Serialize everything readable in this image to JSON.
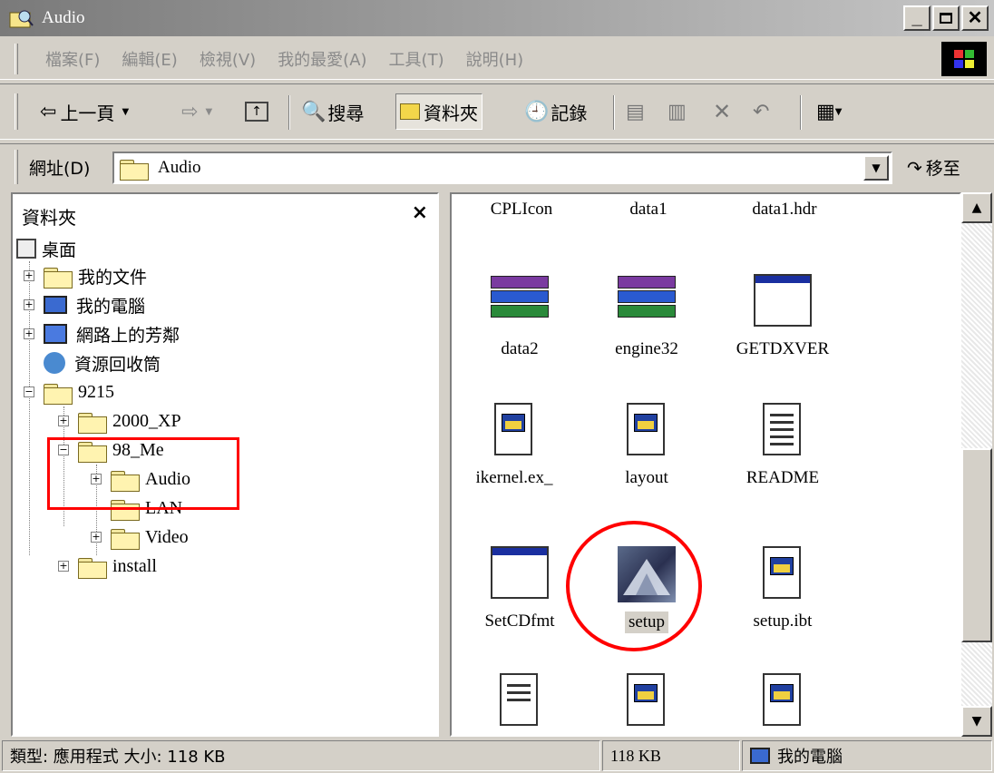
{
  "window": {
    "title": "Audio"
  },
  "menu": [
    "檔案(F)",
    "編輯(E)",
    "檢視(V)",
    "我的最愛(A)",
    "工具(T)",
    "說明(H)"
  ],
  "toolbar": {
    "back_label": "上一頁",
    "search_label": "搜尋",
    "folders_label": "資料夾",
    "history_label": "記錄"
  },
  "address": {
    "label": "網址(D)",
    "value": "Audio",
    "go_label": "移至"
  },
  "folders_pane": {
    "title": "資料夾",
    "tree": {
      "desktop": "桌面",
      "my_documents": "我的文件",
      "my_computer": "我的電腦",
      "network": "網路上的芳鄰",
      "recycle": "資源回收筒",
      "n9215": "9215",
      "n2000xp": "2000_XP",
      "n98me": "98_Me",
      "audio": "Audio",
      "lan": "LAN",
      "video": "Video",
      "install": "install"
    }
  },
  "files": {
    "cplicon": "CPLIcon",
    "data1": "data1",
    "data1hdr": "data1.hdr",
    "data2": "data2",
    "engine32": "engine32",
    "getdxver": "GETDXVER",
    "ikernel": "ikernel.ex_",
    "layout": "layout",
    "readme": "README",
    "setcdfmt": "SetCDfmt",
    "setup": "setup",
    "setupibt": "setup.ibt"
  },
  "status": {
    "info": "類型: 應用程式 大小: 118 KB",
    "size": "118 KB",
    "location": "我的電腦"
  },
  "colors": {
    "highlight": "#ff0000",
    "title_start": "#7a7a7a",
    "title_end": "#c6c6c6"
  }
}
